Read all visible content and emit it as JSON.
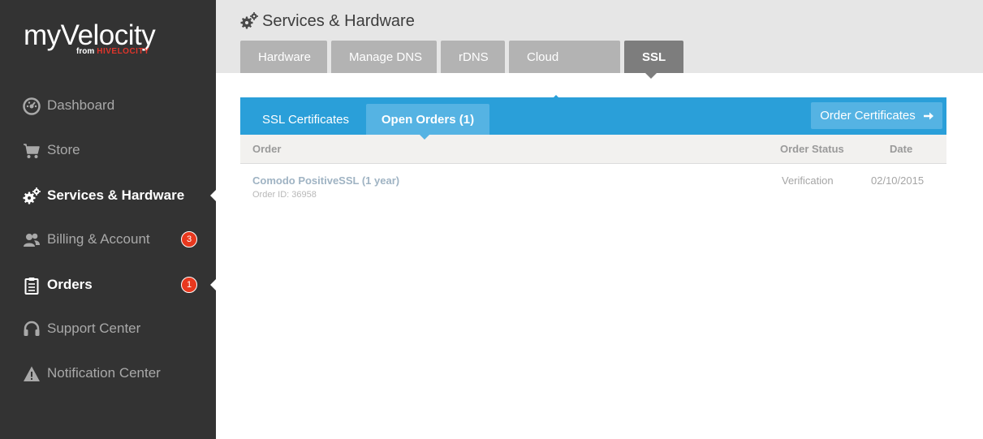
{
  "brand": {
    "name": "myVelocity",
    "from": "from",
    "company": "HIVELOCITY",
    "accent_color": "#e0352b"
  },
  "sidebar": {
    "items": [
      {
        "label": "Dashboard",
        "icon": "dashboard-icon",
        "active": false
      },
      {
        "label": "Store",
        "icon": "cart-icon",
        "active": false
      },
      {
        "label": "Services & Hardware",
        "icon": "gear-icon",
        "active": true
      },
      {
        "label": "Billing & Account",
        "icon": "users-icon",
        "active": false,
        "badge": "3"
      },
      {
        "label": "Orders",
        "icon": "clipboard-icon",
        "active": true,
        "badge": "1"
      },
      {
        "label": "Support Center",
        "icon": "headset-icon",
        "active": false
      },
      {
        "label": "Notification Center",
        "icon": "warning-icon",
        "active": false
      }
    ]
  },
  "header": {
    "title": "Services & Hardware",
    "title_icon": "gear-icon",
    "tabs": [
      {
        "label": "Hardware",
        "active": false
      },
      {
        "label": "Manage DNS",
        "active": false
      },
      {
        "label": "rDNS",
        "active": false
      },
      {
        "label": "Cloud",
        "active": false
      },
      {
        "label": "SSL",
        "active": true
      }
    ]
  },
  "panel": {
    "tabs": [
      {
        "label": "SSL Certificates",
        "active": false
      },
      {
        "label": "Open Orders (1)",
        "active": true
      }
    ],
    "order_button": "Order Certificates",
    "order_button_icon": "arrow-right-icon",
    "accent_color": "#2a9fd9"
  },
  "table": {
    "columns": [
      "Order",
      "Order Status",
      "Date"
    ],
    "rows": [
      {
        "name": "Comodo PositiveSSL (1 year)",
        "order_id": "Order ID: 36958",
        "status": "Verification",
        "date": "02/10/2015"
      }
    ]
  }
}
